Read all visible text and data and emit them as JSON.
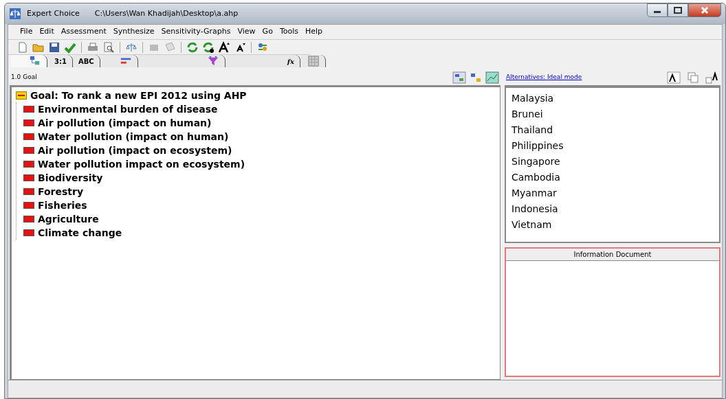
{
  "window": {
    "title": "Expert Choice",
    "path": "C:\\Users\\Wan Khadijah\\Desktop\\a.ahp"
  },
  "menu": [
    "File",
    "Edit",
    "Assessment",
    "Synthesize",
    "Sensitivity-Graphs",
    "View",
    "Go",
    "Tools",
    "Help"
  ],
  "tabs": [
    {
      "kind": "tree",
      "selected": true
    },
    {
      "kind": "text",
      "label": "3:1",
      "selected": false
    },
    {
      "kind": "text",
      "label": "ABC",
      "selected": false
    },
    {
      "kind": "bars",
      "selected": false
    },
    {
      "kind": "funnel",
      "selected": false
    },
    {
      "kind": "formula",
      "label": "fx",
      "selected": false
    },
    {
      "kind": "grid",
      "selected": false
    }
  ],
  "model_pane": {
    "header": "1.0 Goal",
    "tree": [
      {
        "label": "Goal: To rank a new EPI 2012 using AHP",
        "kind": "goal",
        "expanded": true,
        "children": [
          {
            "label": "Environmental burden of disease",
            "kind": "objective"
          },
          {
            "label": "Air pollution (impact on human)",
            "kind": "objective"
          },
          {
            "label": "Water pollution (impact on human)",
            "kind": "objective"
          },
          {
            "label": "Air pollution (impact on ecosystem)",
            "kind": "objective"
          },
          {
            "label": "Water pollution impact on ecosystem)",
            "kind": "objective"
          },
          {
            "label": "Biodiversity",
            "kind": "objective"
          },
          {
            "label": "Forestry",
            "kind": "objective"
          },
          {
            "label": "Fisheries",
            "kind": "objective"
          },
          {
            "label": "Agriculture",
            "kind": "objective"
          },
          {
            "label": "Climate change",
            "kind": "objective"
          }
        ]
      }
    ]
  },
  "alternatives_pane": {
    "header": "Alternatives: Ideal mode",
    "items": [
      "Malaysia",
      "Brunei",
      "Thailand",
      "Philippines",
      "Singapore",
      "Cambodia",
      "Myanmar",
      "Indonesia",
      "Vietnam"
    ]
  },
  "information_document": {
    "title": "Information Document"
  }
}
